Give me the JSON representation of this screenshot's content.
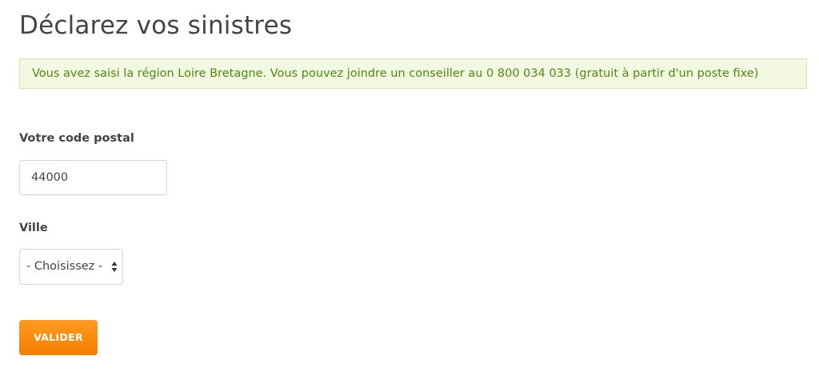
{
  "page": {
    "title": "Déclarez vos sinistres"
  },
  "alert": {
    "message": "Vous avez saisi la région Loire Bretagne. Vous pouvez joindre un conseiller au 0 800 034 033 (gratuit à partir d'un poste fixe)",
    "text_color": "#4f8a10",
    "background_color": "#f3f8e2",
    "border_color": "#d6e59c"
  },
  "form": {
    "postal_code": {
      "label": "Votre code postal",
      "value": "44000"
    },
    "city": {
      "label": "Ville",
      "selected": "- Choisissez -",
      "icon": "select-arrows-icon"
    },
    "submit": {
      "label": "VALIDER",
      "color": "#f7890c"
    }
  }
}
